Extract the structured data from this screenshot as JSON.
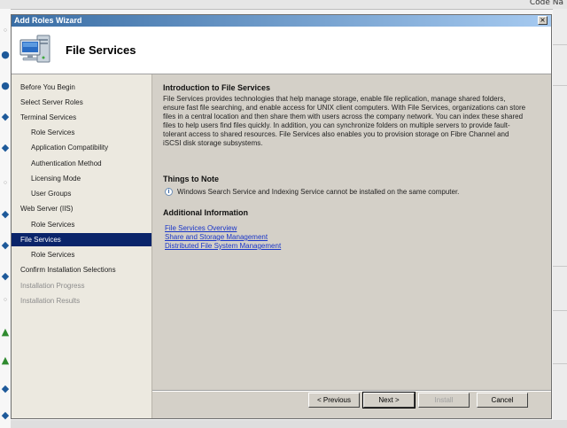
{
  "background": {
    "topbar_text": "Code Na"
  },
  "window": {
    "title": "Add Roles Wizard",
    "close_glyph": "×"
  },
  "header": {
    "title": "File Services",
    "icon": "server-computer-icon"
  },
  "nav": {
    "items": [
      {
        "label": "Before You Begin",
        "level": 1,
        "state": "normal"
      },
      {
        "label": "Select Server Roles",
        "level": 1,
        "state": "normal"
      },
      {
        "label": "Terminal Services",
        "level": 1,
        "state": "normal"
      },
      {
        "label": "Role Services",
        "level": 2,
        "state": "normal"
      },
      {
        "label": "Application Compatibility",
        "level": 2,
        "state": "normal"
      },
      {
        "label": "Authentication Method",
        "level": 2,
        "state": "normal"
      },
      {
        "label": "Licensing Mode",
        "level": 2,
        "state": "normal"
      },
      {
        "label": "User Groups",
        "level": 2,
        "state": "normal"
      },
      {
        "label": "Web Server (IIS)",
        "level": 1,
        "state": "normal"
      },
      {
        "label": "Role Services",
        "level": 2,
        "state": "normal"
      },
      {
        "label": "File Services",
        "level": 1,
        "state": "active"
      },
      {
        "label": "Role Services",
        "level": 2,
        "state": "normal"
      },
      {
        "label": "Confirm Installation Selections",
        "level": 1,
        "state": "normal"
      },
      {
        "label": "Installation Progress",
        "level": 1,
        "state": "disabled"
      },
      {
        "label": "Installation Results",
        "level": 1,
        "state": "disabled"
      }
    ]
  },
  "content": {
    "intro_heading": "Introduction to File Services",
    "intro_body": "File Services provides technologies that help manage storage, enable file replication, manage shared folders, ensure fast file searching, and enable access for UNIX client computers. With File Services, organizations can store files in a central location and then share them with users across the company network. You can index these shared files to help users find files quickly. In addition, you can synchronize folders on multiple servers to provide fault-tolerant access to shared resources. File Services also enables you to provision storage on Fibre Channel and iSCSI disk storage subsystems.",
    "note_heading": "Things to Note",
    "note_text": "Windows Search Service and Indexing Service cannot be installed on the same computer.",
    "additional_heading": "Additional Information",
    "links": [
      "File Services Overview",
      "Share and Storage Management",
      "Distributed File System Management"
    ]
  },
  "buttons": {
    "previous": "< Previous",
    "next": "Next >",
    "install": "Install",
    "cancel": "Cancel"
  }
}
